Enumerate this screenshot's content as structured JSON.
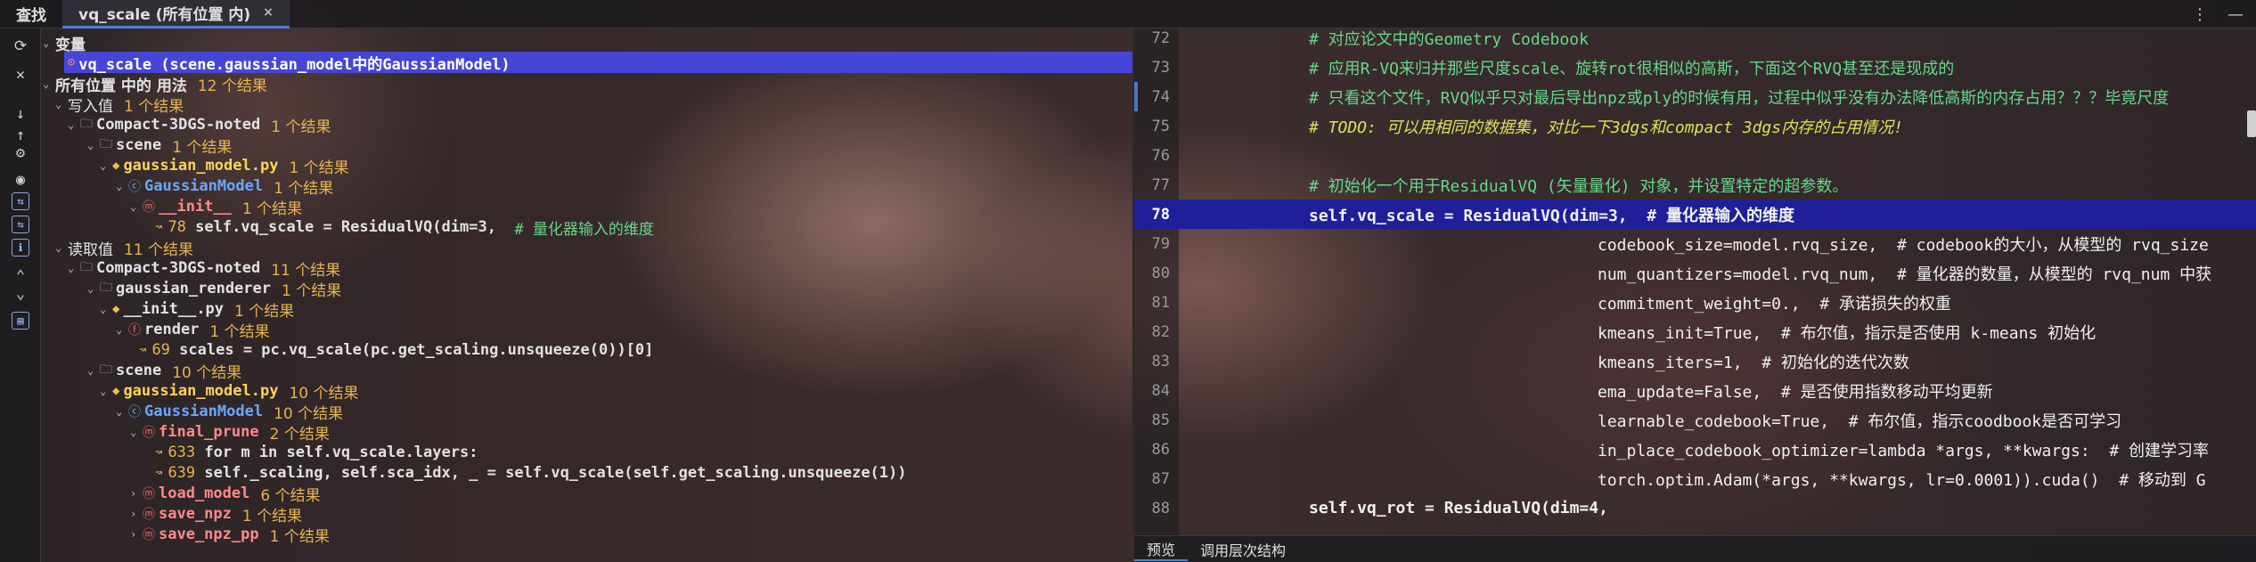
{
  "topbar": {
    "find_label": "查找",
    "tab_label": "vq_scale (所有位置 内)",
    "close": "×",
    "more_icon": "⋮",
    "minimize_icon": "—"
  },
  "strip_icons": [
    "refresh-icon",
    "close-icon",
    "gear-icon",
    "down-arrow-icon",
    "up-arrow-icon",
    "pin-icon",
    "eye-icon",
    "expand-icon",
    "settings-icon",
    "collapse-icon",
    "preview-icon"
  ],
  "tree": {
    "variables_label": "变量",
    "selected_variable": "vq_scale (scene.gaussian_model中的GaussianModel)",
    "usages_label": "所有位置 中的 用法",
    "usages_count": "12 个结果",
    "write_label": "写入值",
    "write_count": "1 个结果",
    "write_project": "Compact-3DGS-noted",
    "write_project_count": "1 个结果",
    "write_scene": "scene",
    "write_scene_count": "1 个结果",
    "write_file": "gaussian_model.py",
    "write_file_count": "1 个结果",
    "write_class": "GaussianModel",
    "write_class_count": "1 个结果",
    "write_method": "__init__",
    "write_method_count": "1 个结果",
    "write_line_no": "78",
    "write_line_code": "self.vq_scale = ResidualVQ(dim=3,",
    "write_line_comment": "# 量化器输入的维度",
    "read_label": "读取值",
    "read_count": "11 个结果",
    "read_project": "Compact-3DGS-noted",
    "read_project_count": "11 个结果",
    "read_renderer": "gaussian_renderer",
    "read_renderer_count": "1 个结果",
    "read_init_file": "__init__.py",
    "read_init_file_count": "1 个结果",
    "read_render": "render",
    "read_render_count": "1 个结果",
    "read_render_line_no": "69",
    "read_render_line_code": "scales = pc.vq_scale(pc.get_scaling.unsqueeze(0))[0]",
    "read_scene": "scene",
    "read_scene_count": "10 个结果",
    "read_file": "gaussian_model.py",
    "read_file_count": "10 个结果",
    "read_class": "GaussianModel",
    "read_class_count": "10 个结果",
    "read_final_prune": "final_prune",
    "read_final_prune_count": "2 个结果",
    "read_line633_no": "633",
    "read_line633_code": "for m in self.vq_scale.layers:",
    "read_line639_no": "639",
    "read_line639_code": "self._scaling, self.sca_idx, _ = self.vq_scale(self.get_scaling.unsqueeze(1))",
    "read_load_model": "load_model",
    "read_load_model_count": "6 个结果",
    "read_save_npz": "save_npz",
    "read_save_npz_count": "1 个结果",
    "read_save_npz_pp": "save_npz_pp",
    "read_save_npz_pp_count": "1 个结果"
  },
  "editor": {
    "lines": [
      {
        "no": "72",
        "text": "# 对应论文中的Geometry Codebook"
      },
      {
        "no": "73",
        "text": "# 应用R-VQ来归并那些尺度scale、旋转rot很相似的高斯，下面这个RVQ甚至还是现成的"
      },
      {
        "no": "74",
        "text": "# 只看这个文件，RVQ似乎只对最后导出npz或ply的时候有用，过程中似乎没有办法降低高斯的内存占用？？？毕竟尺度"
      },
      {
        "no": "75",
        "text": "# TODO: 可以用相同的数据集，对比一下3dgs和compact 3dgs内存的占用情况!"
      },
      {
        "no": "76",
        "text": ""
      },
      {
        "no": "77",
        "text": "# 初始化一个用于ResidualVQ (矢量量化) 对象，并设置特定的超参数。"
      },
      {
        "no": "78",
        "text": "self.vq_scale = ResidualVQ(dim=3,  # 量化器输入的维度"
      },
      {
        "no": "79",
        "text": "codebook_size=model.rvq_size,  # codebook的大小，从模型的 rvq_size"
      },
      {
        "no": "80",
        "text": "num_quantizers=model.rvq_num,  # 量化器的数量，从模型的 rvq_num 中获"
      },
      {
        "no": "81",
        "text": "commitment_weight=0.,  # 承诺损失的权重"
      },
      {
        "no": "82",
        "text": "kmeans_init=True,  # 布尔值，指示是否使用 k-means 初始化"
      },
      {
        "no": "83",
        "text": "kmeans_iters=1,  # 初始化的迭代次数"
      },
      {
        "no": "84",
        "text": "ema_update=False,  # 是否使用指数移动平均更新"
      },
      {
        "no": "85",
        "text": "learnable_codebook=True,  # 布尔值，指示coodbook是否可学习"
      },
      {
        "no": "86",
        "text": "in_place_codebook_optimizer=lambda *args, **kwargs:  # 创建学习率"
      },
      {
        "no": "87",
        "text": "torch.optim.Adam(*args, **kwargs, lr=0.0001)).cuda()  # 移动到 G"
      },
      {
        "no": "88",
        "text": "self.vq_rot = ResidualVQ(dim=4,"
      }
    ]
  },
  "bottombar": {
    "preview": "预览",
    "call_hierarchy": "调用层次结构"
  }
}
